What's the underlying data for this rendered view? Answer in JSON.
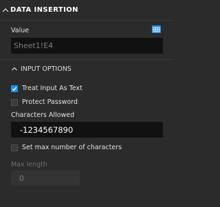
{
  "header": {
    "title": "DATA INSERTION",
    "icon": "chevron-up-icon"
  },
  "value": {
    "label": "Value",
    "field_value": "Sheet1!E4",
    "picker_icon": "table-select-icon"
  },
  "input_options": {
    "title": "INPUT OPTIONS",
    "icon": "chevron-up-icon",
    "treat_input_as_text": {
      "label": "Treat Input As Text",
      "checked": true
    },
    "protect_password": {
      "label": "Protect Password",
      "checked": false
    },
    "characters_allowed": {
      "label": "Characters Allowed",
      "value": "-1234567890"
    },
    "set_max_chars": {
      "label": "Set max number of characters",
      "checked": false
    },
    "max_length": {
      "label": "Max length",
      "value": "0"
    }
  },
  "colors": {
    "accent": "#1b8ef0",
    "background": "#2b2b2b",
    "field": "#111111"
  }
}
